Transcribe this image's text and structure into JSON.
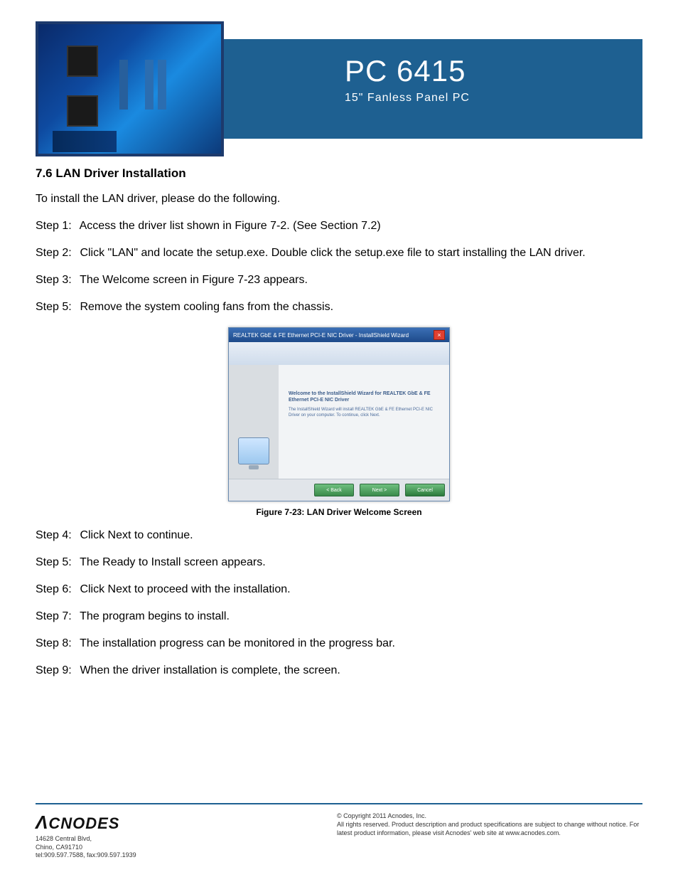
{
  "banner": {
    "title": "PC 6415",
    "subtitle": "15\" Fanless Panel PC"
  },
  "section_title": "7.6 LAN Driver Installation",
  "intro": "To install the LAN driver, please do the following.",
  "steps_a": [
    {
      "label": "Step 1:",
      "text": "Access the driver list shown in Figure 7-2. (See Section 7.2)"
    },
    {
      "label": "Step 2:",
      "text": "Click \"LAN\" and locate the setup.exe. Double click the setup.exe file to start installing the LAN driver."
    },
    {
      "label": "Step 3:",
      "text": "The Welcome screen in Figure 7-23 appears."
    },
    {
      "label": "Step 5:",
      "text": "Remove the system cooling fans from the chassis."
    }
  ],
  "installer": {
    "window_title": "REALTEK GbE & FE Ethernet PCI-E NIC Driver - InstallShield Wizard",
    "heading": "Welcome to the InstallShield Wizard for REALTEK GbE & FE Ethernet PCI-E NIC Driver",
    "body": "The InstallShield Wizard will install REALTEK GbE & FE Ethernet PCI-E NIC Driver on your computer. To continue, click Next.",
    "btn_back": "< Back",
    "btn_next": "Next >",
    "btn_cancel": "Cancel"
  },
  "figure_caption": "Figure 7-23: LAN Driver Welcome Screen",
  "steps_b": [
    {
      "label": "Step 4:",
      "text": "Click Next to continue."
    },
    {
      "label": "Step 5:",
      "text": "The Ready to Install screen appears."
    },
    {
      "label": "Step 6:",
      "text": "Click Next to proceed with the installation."
    },
    {
      "label": "Step 7:",
      "text": "The program begins to install."
    },
    {
      "label": "Step 8:",
      "text": "The installation progress can be monitored in the progress bar."
    },
    {
      "label": "Step 9:",
      "text": "When the driver installation is complete, the screen."
    }
  ],
  "footer": {
    "logo": "CNODES",
    "addr1": "14628 Central Blvd,",
    "addr2": "Chino, CA91710",
    "addr3": "tel:909.597.7588, fax:909.597.1939",
    "copy1": "© Copyright 2011 Acnodes, Inc.",
    "copy2": "All rights reserved. Product description and product specifications are subject to change without notice. For latest product information, please visit Acnodes' web site at www.acnodes.com."
  }
}
